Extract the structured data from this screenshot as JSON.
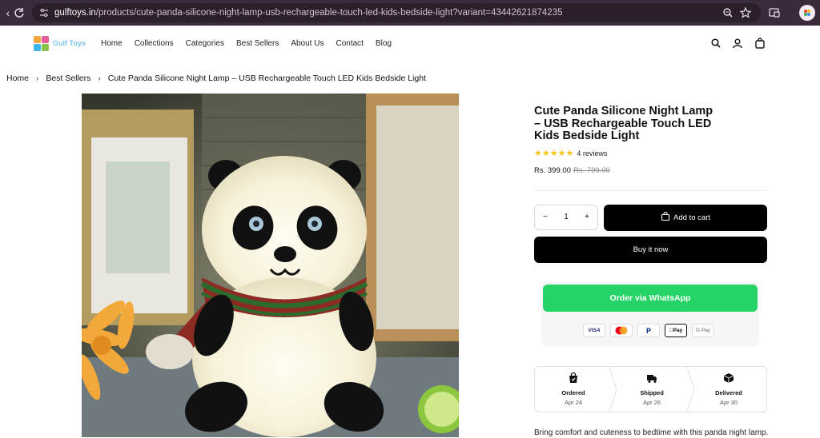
{
  "browser": {
    "url_host": "gulftoys.in",
    "url_path": "/products/cute-panda-silicone-night-lamp-usb-rechargeable-touch-led-kids-bedside-light?variant=43442621874235",
    "icons": [
      "back-icon",
      "reload-icon",
      "site-settings-icon",
      "zoom-icon",
      "bookmark-star-icon",
      "extension-icon",
      "profile-avatar"
    ]
  },
  "header": {
    "logo_text": "Gulf Toys",
    "nav": [
      "Home",
      "Collections",
      "Categories",
      "Best Sellers",
      "About Us",
      "Contact",
      "Blog"
    ],
    "icons": [
      "search-icon",
      "account-icon",
      "cart-icon"
    ]
  },
  "breadcrumb": {
    "items": [
      "Home",
      "Best Sellers",
      "Cute Panda Silicone Night Lamp – USB Rechargeable Touch LED Kids Bedside Light"
    ]
  },
  "product": {
    "title": "Cute Panda Silicone Night Lamp – USB Rechargeable Touch LED Kids Bedside Light",
    "rating": 5,
    "reviews_label": "4 reviews",
    "price": "Rs. 399.00",
    "compare_price": "Rs. 799.00",
    "quantity": "1",
    "qty_minus": "−",
    "qty_plus": "+",
    "add_to_cart": "Add to cart",
    "buy_now": "Buy it now",
    "whatsapp": "Order via WhatsApp",
    "payments": [
      "VISA",
      "Mastercard",
      "PayPal",
      "Apple Pay",
      "G Pay"
    ],
    "delivery": [
      {
        "label": "Ordered",
        "date": "Apr 24",
        "icon": "shopping-bag-icon"
      },
      {
        "label": "Shipped",
        "date": "Apr 26",
        "icon": "truck-icon"
      },
      {
        "label": "Delivered",
        "date": "Apr 30",
        "icon": "package-icon"
      }
    ],
    "description": "Bring comfort and cuteness to bedtime with this panda night lamp."
  },
  "colors": {
    "browser_bar": "#3a2a3b",
    "whatsapp_green": "#25d366",
    "star": "#f5c518",
    "button_black": "#000000"
  }
}
